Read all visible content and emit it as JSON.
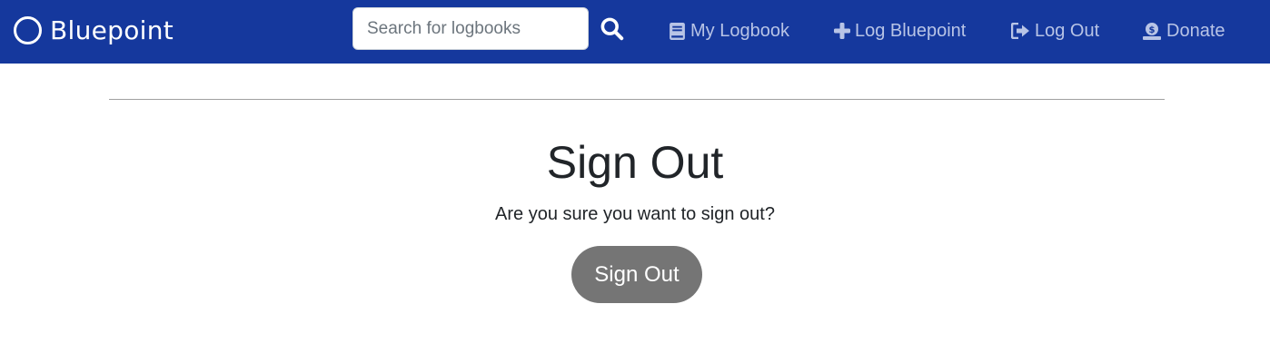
{
  "navbar": {
    "brand": "Bluepoint",
    "search": {
      "placeholder": "Search for logbooks",
      "value": ""
    },
    "links": [
      {
        "label": "My Logbook",
        "icon": "book-icon"
      },
      {
        "label": "Log Bluepoint",
        "icon": "plus-icon"
      },
      {
        "label": "Log Out",
        "icon": "sign-out-icon"
      },
      {
        "label": "Donate",
        "icon": "donate-icon"
      }
    ]
  },
  "main": {
    "title": "Sign Out",
    "message": "Are you sure you want to sign out?",
    "button_label": "Sign Out"
  },
  "colors": {
    "navbar_bg": "#15389d",
    "nav_link": "#b8c4e6",
    "button_bg": "#757575"
  }
}
